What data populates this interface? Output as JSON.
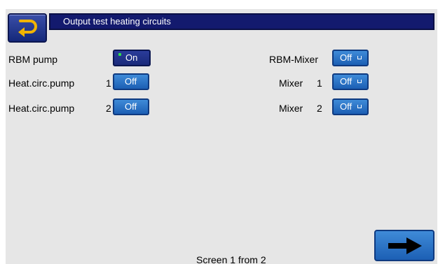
{
  "header": {
    "title": "Output test heating circuits",
    "back_icon": "return-arrow-icon"
  },
  "left": [
    {
      "label": "RBM pump",
      "index": "",
      "state": "On"
    },
    {
      "label": "Heat.circ.pump",
      "index": "1",
      "state": "Off"
    },
    {
      "label": "Heat.circ.pump",
      "index": "2",
      "state": "Off"
    }
  ],
  "right": [
    {
      "label": "RBM-Mixer",
      "index": "",
      "state": "Off"
    },
    {
      "label": "Mixer",
      "index": "1",
      "state": "Off"
    },
    {
      "label": "Mixer",
      "index": "2",
      "state": "Off"
    }
  ],
  "footer": {
    "screen_text": "Screen 1 from 2"
  },
  "nav": {
    "next_icon": "right-arrow-icon"
  },
  "colors": {
    "title_bg": "#131a6e",
    "button_blue": "#1c5fb4",
    "led_green": "#2ee04a"
  }
}
